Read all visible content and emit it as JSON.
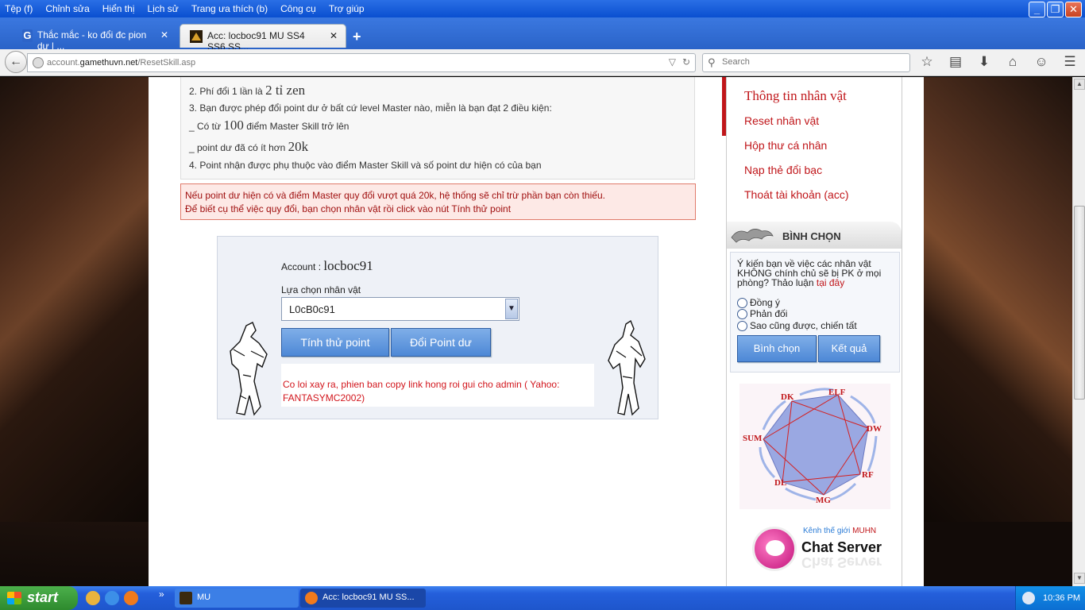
{
  "menubar": {
    "items": [
      "Tệp (f)",
      "Chỉnh sửa",
      "Hiển thị",
      "Lịch sử",
      "Trang ưa thích (b)",
      "Công cụ",
      "Trợ giúp"
    ]
  },
  "tabs": [
    {
      "title": "Thắc mắc - ko đổi đc pion dư | ...",
      "favicon": "G"
    },
    {
      "title": "Acc: locboc91 MU SS4 SS6 SS..."
    }
  ],
  "navbar": {
    "url_domain": "account.gamethuvn.net",
    "url_host_prefix": "account.",
    "url_host_main": "gamethuvn.net",
    "url_path": "/ResetSkill.asp",
    "search_placeholder": "Search"
  },
  "info": {
    "line2_pre": "2. Phí đổi 1 lần là ",
    "line2_big": "2 tỉ zen",
    "line3": "3. Bạn được phép đổi point dư ở bất cứ level Master nào, miễn là bạn đạt 2 điều kiện:",
    "line4_pre": "_ Có từ ",
    "line4_big": "100",
    "line4_post": " điểm Master Skill trở lên",
    "line5_pre": "_ point dư đã có ít hơn ",
    "line5_big": "20k",
    "line6": "4. Point nhận được phụ thuộc vào điểm Master Skill và số point dư hiện có của bạn"
  },
  "warning": {
    "line1": "Nếu point dư hiện có và điểm Master quy đổi vượt quá 20k, hệ thống sẽ chỉ trừ phần bạn còn thiếu.",
    "line2": "Để biết cụ thể việc quy đổi, bạn chọn nhân vật rồi click vào nút Tính thử point"
  },
  "form": {
    "account_label": "Account : ",
    "account_name": "locboc91",
    "choose_label": "Lựa chọn nhân vật",
    "selected_character": "L0cB0c91",
    "btn_calc": "Tính thử point",
    "btn_convert": "Đổi Point dư",
    "error_message": "Co loi xay ra, phien ban copy link hong roi gui cho admin ( Yahoo: FANTASYMC2002)"
  },
  "sidebar": {
    "links": [
      "Thông tin nhân vật",
      "Reset nhân vật",
      "Hộp thư cá nhân",
      "Nạp thẻ đổi bạc",
      "Thoát tài khoản (acc)"
    ],
    "vote_title": "BÌNH CHỌN",
    "vote_question": "Ý kiến bạn về việc các nhân vật KHÔNG chính chủ sẽ bị PK ở mọi phòng? Thảo luận ",
    "vote_link": "tại đây",
    "vote_options": [
      "Đồng ý",
      "Phản đối",
      "Sao cũng được, chiến tất"
    ],
    "btn_vote": "Bình chọn",
    "btn_result": "Kết quả",
    "diagram_labels": [
      "DK",
      "ELF",
      "DW",
      "RF",
      "MG",
      "DL",
      "SUM"
    ],
    "chat_sub_pre": "Kênh thế giới ",
    "chat_sub_brand": "MUHN",
    "chat_title": "Chat Server"
  },
  "taskbar": {
    "start": "start",
    "items": [
      "MU",
      "Acc: locboc91 MU SS..."
    ],
    "time": "10:36 PM"
  },
  "colors": {
    "accent_red": "#c0161a",
    "button_blue": "#4d88d6",
    "xp_taskbar": "#245fdb"
  }
}
